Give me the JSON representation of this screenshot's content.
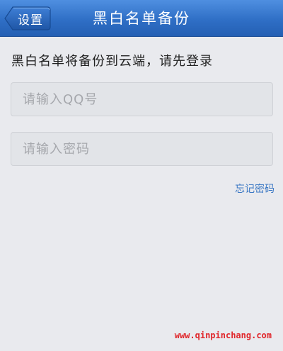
{
  "header": {
    "back_label": "设置",
    "title": "黑白名单备份"
  },
  "main": {
    "prompt": "黑白名单将备份到云端，请先登录",
    "qq_placeholder": "请输入QQ号",
    "password_placeholder": "请输入密码",
    "forgot_password": "忘记密码"
  },
  "watermark": "www.qinpinchang.com",
  "colors": {
    "navbar": "#2f6fc6",
    "background": "#e9eaee",
    "link": "#3b78c4",
    "watermark": "#e0272b"
  },
  "icons": {
    "back": "back-arrow-button"
  }
}
